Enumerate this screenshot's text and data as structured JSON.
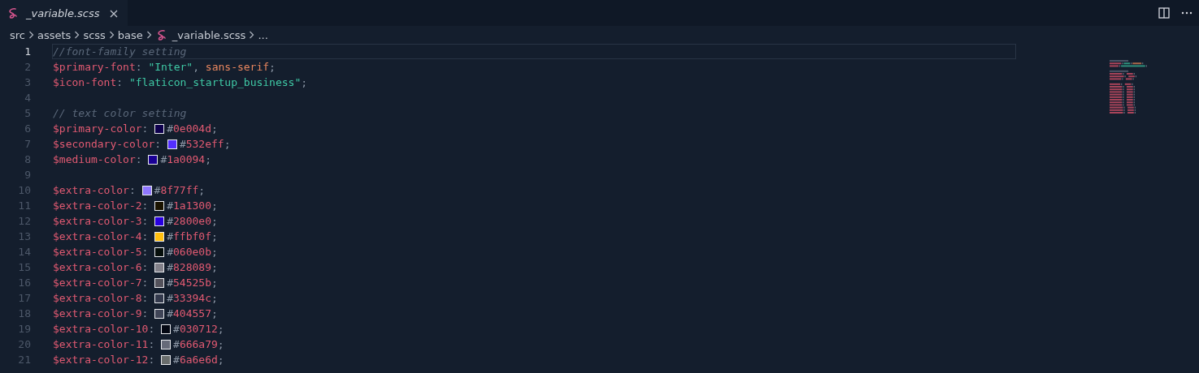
{
  "tab": {
    "title": "_variable.scss",
    "selected": true
  },
  "breadcrumbs": [
    {
      "text": "src",
      "kind": "folder"
    },
    {
      "text": "assets",
      "kind": "folder"
    },
    {
      "text": "scss",
      "kind": "folder"
    },
    {
      "text": "base",
      "kind": "folder"
    },
    {
      "text": "_variable.scss",
      "kind": "file"
    },
    {
      "text": "...",
      "kind": "more"
    }
  ],
  "lines": [
    {
      "number": "1",
      "current": true,
      "tokens": [
        {
          "kind": "comment",
          "text": "//font-family setting"
        }
      ]
    },
    {
      "number": "2",
      "current": false,
      "tokens": [
        {
          "kind": "variable",
          "text": "$primary-font"
        },
        {
          "kind": "punct",
          "text": ":"
        },
        {
          "kind": "string",
          "text": "\"Inter\""
        },
        {
          "kind": "punct",
          "text": ","
        },
        {
          "kind": "keyword",
          "text": "sans-serif"
        },
        {
          "kind": "punct",
          "text": ";"
        }
      ]
    },
    {
      "number": "3",
      "current": false,
      "tokens": [
        {
          "kind": "variable",
          "text": "$icon-font"
        },
        {
          "kind": "punct",
          "text": ":"
        },
        {
          "kind": "string",
          "text": "\"flaticon_startup_business\""
        },
        {
          "kind": "punct",
          "text": ";"
        }
      ]
    },
    {
      "number": "4",
      "current": false
    },
    {
      "number": "5",
      "current": false,
      "tokens": [
        {
          "kind": "comment",
          "text": "// text color setting"
        }
      ]
    },
    {
      "number": "6",
      "current": false,
      "tokens": [
        {
          "kind": "variable",
          "text": "$primary-color"
        },
        {
          "kind": "punct",
          "text": ":"
        },
        {
          "kind": "swatch",
          "color": "#0e004d"
        },
        {
          "kind": "hex",
          "text": "#0e004d"
        },
        {
          "kind": "punct",
          "text": ";"
        }
      ]
    },
    {
      "number": "7",
      "current": false,
      "tokens": [
        {
          "kind": "variable",
          "text": "$secondary-color"
        },
        {
          "kind": "punct",
          "text": ":"
        },
        {
          "kind": "swatch",
          "color": "#532eff"
        },
        {
          "kind": "hex",
          "text": "#532eff"
        },
        {
          "kind": "punct",
          "text": ";"
        }
      ]
    },
    {
      "number": "8",
      "current": false,
      "tokens": [
        {
          "kind": "variable",
          "text": "$medium-color"
        },
        {
          "kind": "punct",
          "text": ":"
        },
        {
          "kind": "swatch",
          "color": "#1a0094"
        },
        {
          "kind": "hex",
          "text": "#1a0094"
        },
        {
          "kind": "punct",
          "text": ";"
        }
      ]
    },
    {
      "number": "9",
      "current": false
    },
    {
      "number": "10",
      "current": false,
      "tokens": [
        {
          "kind": "variable",
          "text": "$extra-color"
        },
        {
          "kind": "punct",
          "text": ":"
        },
        {
          "kind": "swatch",
          "color": "#8f77ff"
        },
        {
          "kind": "hex",
          "text": "#8f77ff"
        },
        {
          "kind": "punct",
          "text": ";"
        }
      ]
    },
    {
      "number": "11",
      "current": false,
      "tokens": [
        {
          "kind": "variable",
          "text": "$extra-color-2"
        },
        {
          "kind": "punct",
          "text": ":"
        },
        {
          "kind": "swatch",
          "color": "#1a1300"
        },
        {
          "kind": "hex",
          "text": "#1a1300"
        },
        {
          "kind": "punct",
          "text": ";"
        }
      ]
    },
    {
      "number": "12",
      "current": false,
      "tokens": [
        {
          "kind": "variable",
          "text": "$extra-color-3"
        },
        {
          "kind": "punct",
          "text": ":"
        },
        {
          "kind": "swatch",
          "color": "#2800e0"
        },
        {
          "kind": "hex",
          "text": "#2800e0"
        },
        {
          "kind": "punct",
          "text": ";"
        }
      ]
    },
    {
      "number": "13",
      "current": false,
      "tokens": [
        {
          "kind": "variable",
          "text": "$extra-color-4"
        },
        {
          "kind": "punct",
          "text": ":"
        },
        {
          "kind": "swatch",
          "color": "#ffbf0f"
        },
        {
          "kind": "hex",
          "text": "#ffbf0f"
        },
        {
          "kind": "punct",
          "text": ";"
        }
      ]
    },
    {
      "number": "14",
      "current": false,
      "tokens": [
        {
          "kind": "variable",
          "text": "$extra-color-5"
        },
        {
          "kind": "punct",
          "text": ":"
        },
        {
          "kind": "swatch",
          "color": "#060e0b"
        },
        {
          "kind": "hex",
          "text": "#060e0b"
        },
        {
          "kind": "punct",
          "text": ";"
        }
      ]
    },
    {
      "number": "15",
      "current": false,
      "tokens": [
        {
          "kind": "variable",
          "text": "$extra-color-6"
        },
        {
          "kind": "punct",
          "text": ":"
        },
        {
          "kind": "swatch",
          "color": "#828089"
        },
        {
          "kind": "hex",
          "text": "#828089"
        },
        {
          "kind": "punct",
          "text": ";"
        }
      ]
    },
    {
      "number": "16",
      "current": false,
      "tokens": [
        {
          "kind": "variable",
          "text": "$extra-color-7"
        },
        {
          "kind": "punct",
          "text": ":"
        },
        {
          "kind": "swatch",
          "color": "#54525b"
        },
        {
          "kind": "hex",
          "text": "#54525b"
        },
        {
          "kind": "punct",
          "text": ";"
        }
      ]
    },
    {
      "number": "17",
      "current": false,
      "tokens": [
        {
          "kind": "variable",
          "text": "$extra-color-8"
        },
        {
          "kind": "punct",
          "text": ":"
        },
        {
          "kind": "swatch",
          "color": "#33394c"
        },
        {
          "kind": "hex",
          "text": "#33394c"
        },
        {
          "kind": "punct",
          "text": ";"
        }
      ]
    },
    {
      "number": "18",
      "current": false,
      "tokens": [
        {
          "kind": "variable",
          "text": "$extra-color-9"
        },
        {
          "kind": "punct",
          "text": ":"
        },
        {
          "kind": "swatch",
          "color": "#404557"
        },
        {
          "kind": "hex",
          "text": "#404557"
        },
        {
          "kind": "punct",
          "text": ";"
        }
      ]
    },
    {
      "number": "19",
      "current": false,
      "tokens": [
        {
          "kind": "variable",
          "text": "$extra-color-10"
        },
        {
          "kind": "punct",
          "text": ":"
        },
        {
          "kind": "swatch",
          "color": "#030712"
        },
        {
          "kind": "hex",
          "text": "#030712"
        },
        {
          "kind": "punct",
          "text": ";"
        }
      ]
    },
    {
      "number": "20",
      "current": false,
      "tokens": [
        {
          "kind": "variable",
          "text": "$extra-color-11"
        },
        {
          "kind": "punct",
          "text": ":"
        },
        {
          "kind": "swatch",
          "color": "#666a79"
        },
        {
          "kind": "hex",
          "text": "#666a79"
        },
        {
          "kind": "punct",
          "text": ";"
        }
      ]
    },
    {
      "number": "21",
      "current": false,
      "tokens": [
        {
          "kind": "variable",
          "text": "$extra-color-12"
        },
        {
          "kind": "punct",
          "text": ":"
        },
        {
          "kind": "swatch",
          "color": "#6a6e6d"
        },
        {
          "kind": "hex",
          "text": "#6a6e6d"
        },
        {
          "kind": "punct",
          "text": ";"
        }
      ]
    }
  ]
}
